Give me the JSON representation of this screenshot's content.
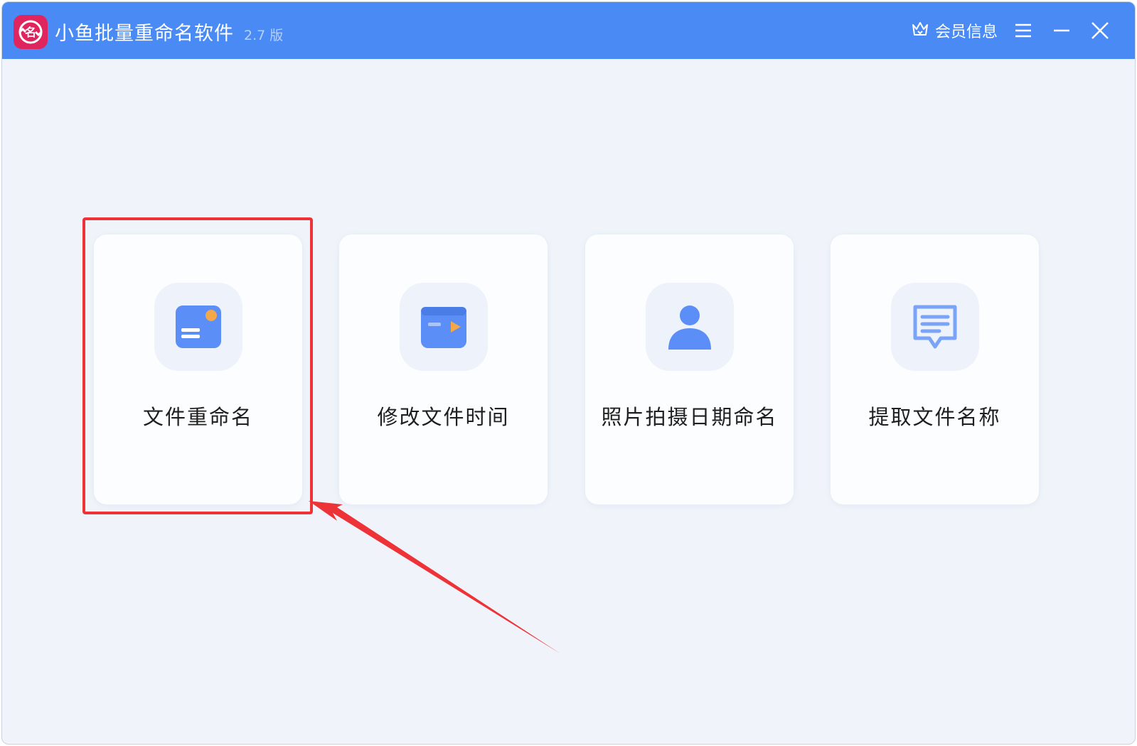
{
  "app": {
    "title": "小鱼批量重命名软件",
    "version": "2.7 版",
    "logo_icon": "rename-logo-icon"
  },
  "titlebar": {
    "member_label": "会员信息",
    "member_icon": "crown-icon",
    "menu_icon": "hamburger-menu-icon",
    "minimize_icon": "minimize-icon",
    "close_icon": "close-icon"
  },
  "cards": [
    {
      "label": "文件重命名",
      "icon": "file-rename-icon"
    },
    {
      "label": "修改文件时间",
      "icon": "folder-time-icon"
    },
    {
      "label": "照片拍摄日期命名",
      "icon": "person-photo-icon"
    },
    {
      "label": "提取文件名称",
      "icon": "message-list-icon"
    }
  ],
  "colors": {
    "titlebar": "#4a8af4",
    "background": "#f0f4fa",
    "card": "#fcfdfe",
    "icon_blue": "#5b8ef7",
    "icon_orange": "#f5a84a",
    "annotation_red": "#ee3338",
    "logo": "#e0245e"
  },
  "annotation": {
    "highlighted_card": "文件重命名"
  }
}
